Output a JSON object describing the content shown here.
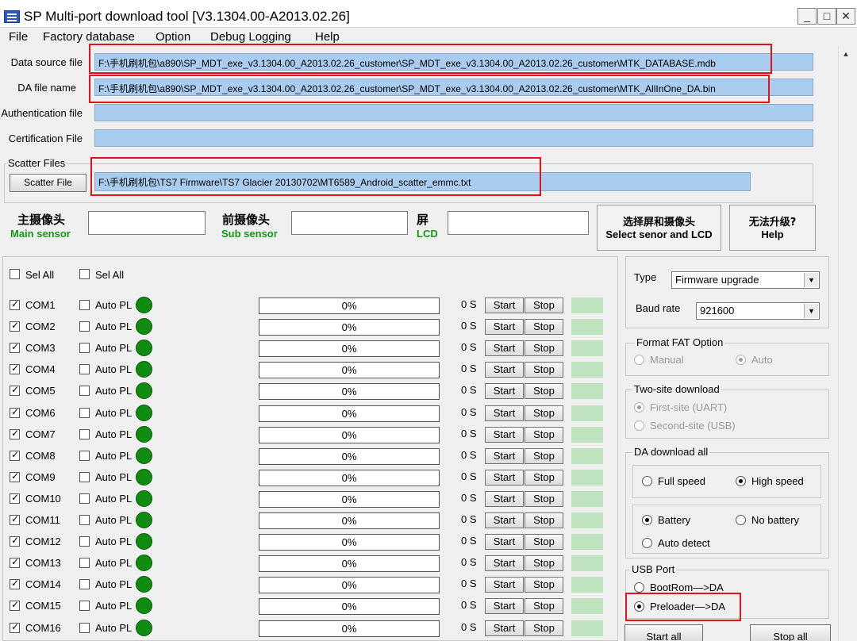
{
  "title": "SP Multi-port download tool [V3.1304.00-A2013.02.26]",
  "window_buttons": {
    "minimize": "_",
    "maximize": "□",
    "close": "✕"
  },
  "menu": [
    "File",
    "Factory database",
    "Option",
    "Debug Logging",
    "Help"
  ],
  "files": {
    "data_source": {
      "label": "Data source file",
      "value": "F:\\手机刷机包\\a890\\SP_MDT_exe_v3.1304.00_A2013.02.26_customer\\SP_MDT_exe_v3.1304.00_A2013.02.26_customer\\MTK_DATABASE.mdb"
    },
    "da_file": {
      "label": "DA file name",
      "value": "F:\\手机刷机包\\a890\\SP_MDT_exe_v3.1304.00_A2013.02.26_customer\\SP_MDT_exe_v3.1304.00_A2013.02.26_customer\\MTK_AllInOne_DA.bin"
    },
    "auth": {
      "label": "Authentication file",
      "value": ""
    },
    "cert": {
      "label": "Certification File",
      "value": ""
    }
  },
  "scatter": {
    "group_title": "Scatter Files",
    "button": "Scatter File",
    "value": "F:\\手机刷机包\\TS7 Firmware\\TS7 Glacier 20130702\\MT6589_Android_scatter_emmc.txt"
  },
  "sensors": {
    "main_cn": "主摄像头",
    "main_en": "Main sensor",
    "sub_cn": "前摄像头",
    "sub_en": "Sub sensor",
    "lcd_cn": "屏",
    "lcd_en": "LCD",
    "select_cn": "选择屏和摄像头",
    "select_en": "Select senor and LCD",
    "help_cn": "无法升级?",
    "help_en": "Help"
  },
  "sel_all": [
    "Sel All",
    "Sel All"
  ],
  "port_labels": {
    "auto": "Auto PL",
    "start": "Start",
    "stop": "Stop"
  },
  "ports": [
    {
      "name": "COM1",
      "progress": "0%",
      "time": "0 S",
      "checked": true
    },
    {
      "name": "COM2",
      "progress": "0%",
      "time": "0 S",
      "checked": true
    },
    {
      "name": "COM3",
      "progress": "0%",
      "time": "0 S",
      "checked": true
    },
    {
      "name": "COM4",
      "progress": "0%",
      "time": "0 S",
      "checked": true
    },
    {
      "name": "COM5",
      "progress": "0%",
      "time": "0 S",
      "checked": true
    },
    {
      "name": "COM6",
      "progress": "0%",
      "time": "0 S",
      "checked": true
    },
    {
      "name": "COM7",
      "progress": "0%",
      "time": "0 S",
      "checked": true
    },
    {
      "name": "COM8",
      "progress": "0%",
      "time": "0 S",
      "checked": true
    },
    {
      "name": "COM9",
      "progress": "0%",
      "time": "0 S",
      "checked": true
    },
    {
      "name": "COM10",
      "progress": "0%",
      "time": "0 S",
      "checked": true
    },
    {
      "name": "COM11",
      "progress": "0%",
      "time": "0 S",
      "checked": true
    },
    {
      "name": "COM12",
      "progress": "0%",
      "time": "0 S",
      "checked": true
    },
    {
      "name": "COM13",
      "progress": "0%",
      "time": "0 S",
      "checked": true
    },
    {
      "name": "COM14",
      "progress": "0%",
      "time": "0 S",
      "checked": true
    },
    {
      "name": "COM15",
      "progress": "0%",
      "time": "0 S",
      "checked": true
    },
    {
      "name": "COM16",
      "progress": "0%",
      "time": "0 S",
      "checked": true
    }
  ],
  "settings": {
    "type_label": "Type",
    "type_value": "Firmware upgrade",
    "baud_label": "Baud rate",
    "baud_value": "921600"
  },
  "format_fat": {
    "title": "Format FAT Option",
    "manual": "Manual",
    "auto": "Auto"
  },
  "two_site": {
    "title": "Two-site download",
    "first": "First-site (UART)",
    "second": "Second-site (USB)"
  },
  "da_download": {
    "title": "DA download all",
    "full": "Full speed",
    "high": "High speed",
    "battery": "Battery",
    "no_battery": "No battery",
    "auto_detect": "Auto detect"
  },
  "usb_port": {
    "title": "USB Port",
    "bootrom": "BootRom—>DA",
    "preloader": "Preloader—>DA"
  },
  "bottom": {
    "start_all": "Start all",
    "stop_all": "Stop all"
  }
}
